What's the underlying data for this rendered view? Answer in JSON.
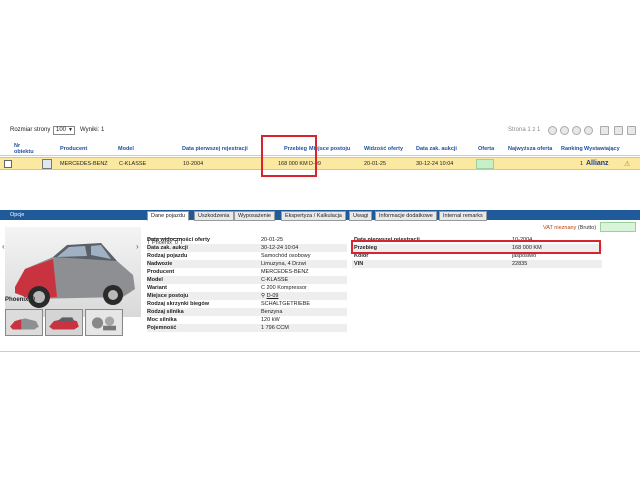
{
  "toolbar": {
    "page_size_label": "Rozmiar strony",
    "page_size_value": "100",
    "results_label": "Wyniki: 1",
    "pager_text": "Strona 1 z 1"
  },
  "table": {
    "headers": {
      "nr": "Nr obiektu",
      "producer": "Producent",
      "model": "Model",
      "first_reg": "Data pierwszej rejestracji",
      "mileage": "Przebieg",
      "location": "Miejsce postoju",
      "visible": "Widzość oferty",
      "end_date": "Data zak. aukcji",
      "offer": "Oferta",
      "best_offer": "Najwyższa oferta",
      "ranking": "Ranking",
      "seller": "Wystawiający"
    },
    "row": {
      "producer": "MERCEDES-BENZ",
      "model": "C-KLASSE",
      "first_reg": "10-2004",
      "mileage": "168 000 KM",
      "location": "D-09",
      "visible": "20-01-25",
      "end_date": "30-12-24 10:04",
      "ranking": "1",
      "seller": "Allianz"
    }
  },
  "options_bar": {
    "label": "Opcje"
  },
  "tabs": [
    "Dane pojazdu",
    "Uszkodzenia",
    "Wyposażenie",
    "Ekspertyza / Kalkulacja",
    "Uwagi",
    "Informacje dodatkowe",
    "Internal remarks"
  ],
  "vat": {
    "label": "VAT nieznany",
    "suffix": "(Brutto)"
  },
  "gallery": {
    "caption": "Phoenix_0",
    "tooltip": "Phoenix_0"
  },
  "details_left": [
    {
      "k": "Data widoczności oferty",
      "v": "20-01-25"
    },
    {
      "k": "Data zak. aukcji",
      "v": "30-12-24 10:04"
    },
    {
      "k": "Rodzaj pojazdu",
      "v": "Samochód osobowy"
    },
    {
      "k": "Nadwozie",
      "v": "Limuzyna, 4 Drzwi"
    },
    {
      "k": "Producent",
      "v": "MERCEDES-BENZ"
    },
    {
      "k": "Model",
      "v": "C-KLASSE"
    },
    {
      "k": "Wariant",
      "v": "C 200 Kompressor"
    },
    {
      "k": "Miejsce postoju",
      "v": "D-09"
    },
    {
      "k": "Rodzaj skrzynki biegów",
      "v": "SCHALTGETRIEBE"
    },
    {
      "k": "Rodzaj silnika",
      "v": "Benzyna"
    },
    {
      "k": "Moc silnika",
      "v": "120 kW"
    },
    {
      "k": "Pojemność",
      "v": "1 796 CCM"
    }
  ],
  "details_right": [
    {
      "k": "Data pierwszej rejestracji",
      "v": "10-2004"
    },
    {
      "k": "Przebieg",
      "v": "168 000 KM"
    },
    {
      "k": "Kolor",
      "v": "jasposiwo"
    },
    {
      "k": "VIN",
      "v": "22835"
    }
  ],
  "colors": {
    "row_highlight": "#fbe9a2",
    "header_text": "#1f4fa0",
    "options_bar": "#1f5a9a",
    "annotation": "#d9232e"
  }
}
